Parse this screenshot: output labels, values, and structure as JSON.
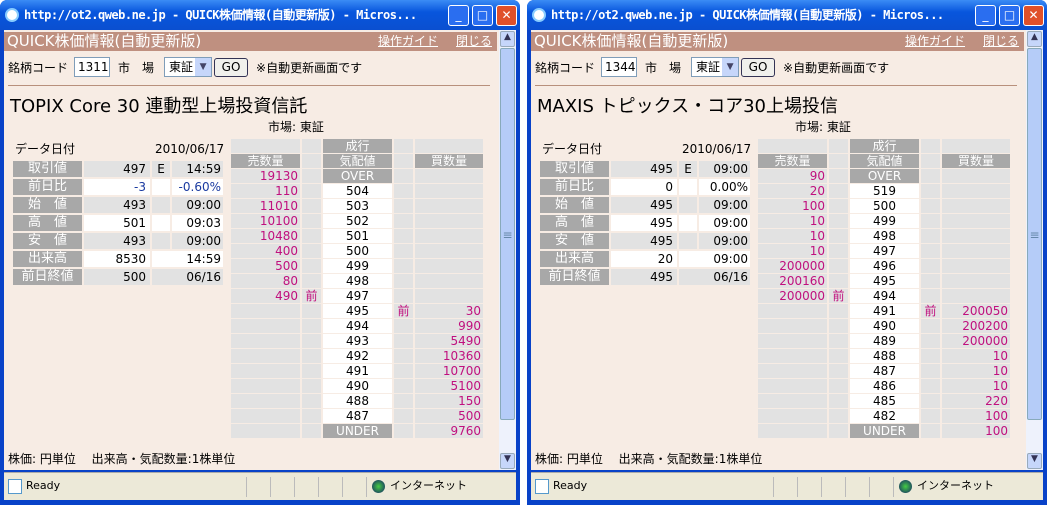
{
  "windows": [
    {
      "title": "http://ot2.qweb.ne.jp - QUICK株価情報(自動更新版) - Micros...",
      "header": "QUICK株価情報(自動更新版)",
      "guide": "操作ガイド",
      "close": "閉じる",
      "code_label": "銘柄コード",
      "code": "1311",
      "market_label": "市　場",
      "market": "東証",
      "go": "GO",
      "note": "※自動更新画面です",
      "name": "TOPIX Core 30 連動型上場投資信託",
      "market_line": "市場: 東証",
      "date_label": "データ日付",
      "date": "2010/06/17",
      "rows": [
        {
          "label": "取引値",
          "v": "497",
          "f": "E",
          "t": "14:59"
        },
        {
          "label": "前日比",
          "v": "-3",
          "f": "",
          "t": "-0.60%"
        },
        {
          "label": "始　値",
          "v": "493",
          "f": "",
          "t": "09:00"
        },
        {
          "label": "高　値",
          "v": "501",
          "f": "",
          "t": "09:03"
        },
        {
          "label": "安　値",
          "v": "493",
          "f": "",
          "t": "09:00"
        },
        {
          "label": "出来高",
          "v": "8530",
          "f": "",
          "t": "14:59"
        },
        {
          "label": "前日終値",
          "v": "500",
          "f": "",
          "t": "06/16"
        }
      ],
      "book_head": {
        "market_order": "成行",
        "sell": "売数量",
        "price": "気配値",
        "buy": "買数量"
      },
      "book": [
        [
          "19130",
          "",
          "OVER",
          "",
          ""
        ],
        [
          "110",
          "",
          "504",
          "",
          ""
        ],
        [
          "11010",
          "",
          "503",
          "",
          ""
        ],
        [
          "10100",
          "",
          "502",
          "",
          ""
        ],
        [
          "10480",
          "",
          "501",
          "",
          ""
        ],
        [
          "400",
          "",
          "500",
          "",
          ""
        ],
        [
          "500",
          "",
          "499",
          "",
          ""
        ],
        [
          "80",
          "",
          "498",
          "",
          ""
        ],
        [
          "490",
          "前",
          "497",
          "",
          ""
        ],
        [
          "",
          "",
          "495",
          "前",
          "30"
        ],
        [
          "",
          "",
          "494",
          "",
          "990"
        ],
        [
          "",
          "",
          "493",
          "",
          "5490"
        ],
        [
          "",
          "",
          "492",
          "",
          "10360"
        ],
        [
          "",
          "",
          "491",
          "",
          "10700"
        ],
        [
          "",
          "",
          "490",
          "",
          "5100"
        ],
        [
          "",
          "",
          "488",
          "",
          "150"
        ],
        [
          "",
          "",
          "487",
          "",
          "500"
        ],
        [
          "",
          "",
          "UNDER",
          "",
          "9760"
        ]
      ],
      "footer": "株価: 円単位　 出来高・気配数量:1株単位",
      "status": "Ready",
      "zone": "インターネット"
    },
    {
      "title": "http://ot2.qweb.ne.jp - QUICK株価情報(自動更新版) - Micros...",
      "header": "QUICK株価情報(自動更新版)",
      "guide": "操作ガイド",
      "close": "閉じる",
      "code_label": "銘柄コード",
      "code": "1344",
      "market_label": "市　場",
      "market": "東証",
      "go": "GO",
      "note": "※自動更新画面です",
      "name": "MAXIS トピックス・コア30上場投信",
      "market_line": "市場: 東証",
      "date_label": "データ日付",
      "date": "2010/06/17",
      "rows": [
        {
          "label": "取引値",
          "v": "495",
          "f": "E",
          "t": "09:00"
        },
        {
          "label": "前日比",
          "v": "0",
          "f": "",
          "t": "0.00%"
        },
        {
          "label": "始　値",
          "v": "495",
          "f": "",
          "t": "09:00"
        },
        {
          "label": "高　値",
          "v": "495",
          "f": "",
          "t": "09:00"
        },
        {
          "label": "安　値",
          "v": "495",
          "f": "",
          "t": "09:00"
        },
        {
          "label": "出来高",
          "v": "20",
          "f": "",
          "t": "09:00"
        },
        {
          "label": "前日終値",
          "v": "495",
          "f": "",
          "t": "06/16"
        }
      ],
      "book_head": {
        "market_order": "成行",
        "sell": "売数量",
        "price": "気配値",
        "buy": "買数量"
      },
      "book": [
        [
          "90",
          "",
          "OVER",
          "",
          ""
        ],
        [
          "20",
          "",
          "519",
          "",
          ""
        ],
        [
          "100",
          "",
          "500",
          "",
          ""
        ],
        [
          "10",
          "",
          "499",
          "",
          ""
        ],
        [
          "10",
          "",
          "498",
          "",
          ""
        ],
        [
          "10",
          "",
          "497",
          "",
          ""
        ],
        [
          "200000",
          "",
          "496",
          "",
          ""
        ],
        [
          "200160",
          "",
          "495",
          "",
          ""
        ],
        [
          "200000",
          "前",
          "494",
          "",
          ""
        ],
        [
          "",
          "",
          "491",
          "前",
          "200050"
        ],
        [
          "",
          "",
          "490",
          "",
          "200200"
        ],
        [
          "",
          "",
          "489",
          "",
          "200000"
        ],
        [
          "",
          "",
          "488",
          "",
          "10"
        ],
        [
          "",
          "",
          "487",
          "",
          "10"
        ],
        [
          "",
          "",
          "486",
          "",
          "10"
        ],
        [
          "",
          "",
          "485",
          "",
          "220"
        ],
        [
          "",
          "",
          "482",
          "",
          "100"
        ],
        [
          "",
          "",
          "UNDER",
          "",
          "100"
        ]
      ],
      "footer": "株価: 円単位　 出来高・気配数量:1株単位",
      "status": "Ready",
      "zone": "インターネット"
    }
  ]
}
